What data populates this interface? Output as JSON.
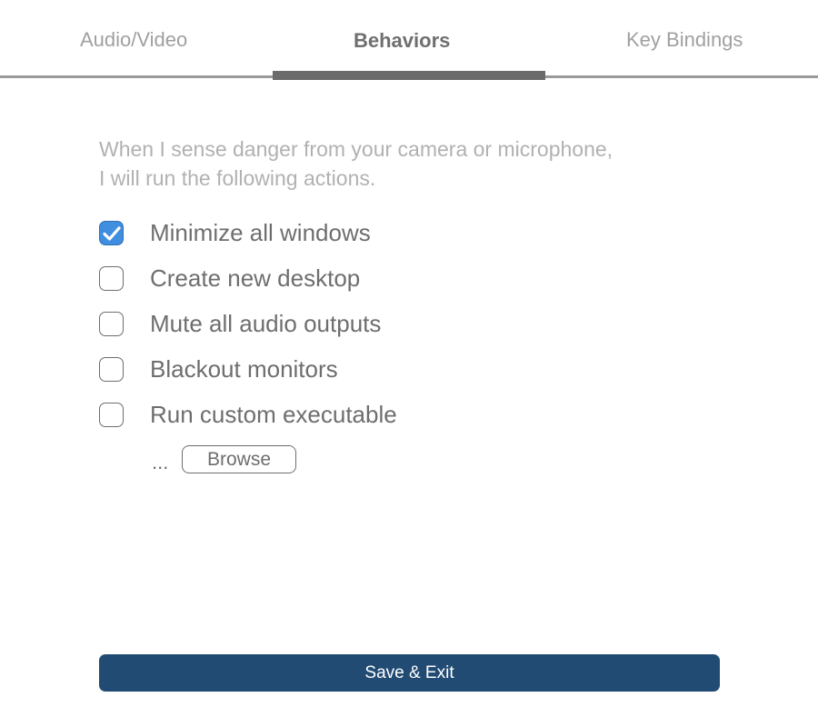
{
  "tabs": [
    {
      "label": "Audio/Video",
      "active": false
    },
    {
      "label": "Behaviors",
      "active": true
    },
    {
      "label": "Key Bindings",
      "active": false
    }
  ],
  "intro": {
    "line1": "When I sense danger from your camera or microphone,",
    "line2": "I will run the following actions."
  },
  "options": [
    {
      "label": "Minimize all windows",
      "checked": true
    },
    {
      "label": "Create new desktop",
      "checked": false
    },
    {
      "label": "Mute all audio outputs",
      "checked": false
    },
    {
      "label": "Blackout monitors",
      "checked": false
    },
    {
      "label": "Run custom executable",
      "checked": false
    }
  ],
  "executable": {
    "path_display": "...",
    "browse_label": "Browse"
  },
  "footer": {
    "save_label": "Save & Exit"
  },
  "colors": {
    "accent": "#3f8ee0",
    "save_button": "#224b74",
    "tab_indicator": "#6b6b6b"
  },
  "icons": {
    "checkmark": "check-icon"
  }
}
